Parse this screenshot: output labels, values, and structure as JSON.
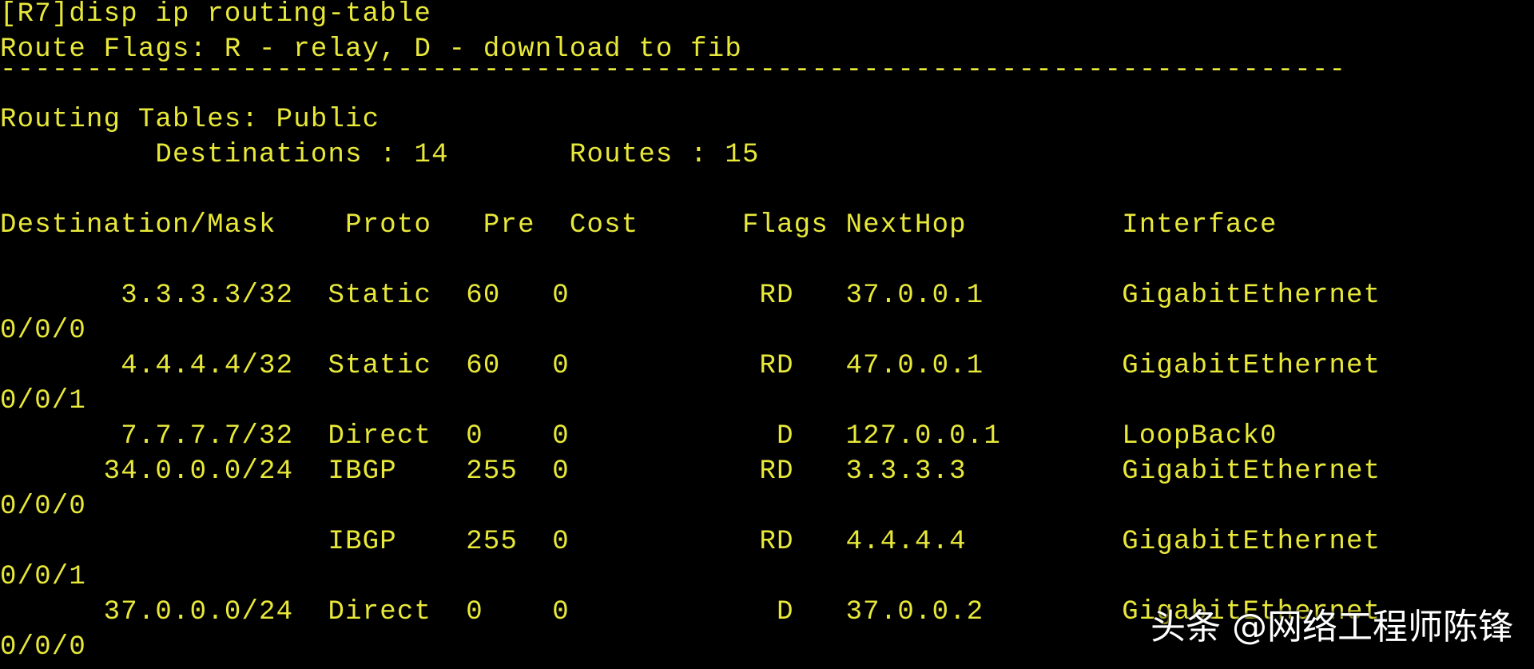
{
  "terminal": {
    "command": "[R7]disp ip routing-table",
    "flags_legend": "Route Flags: R - relay, D - download to fib",
    "separator": "------------------------------------------------------------------------------",
    "table_name": "Routing Tables: Public",
    "summary": "         Destinations : 14       Routes : 15",
    "header": "Destination/Mask    Proto   Pre  Cost      Flags NextHop         Interface",
    "rows": [
      "       3.3.3.3/32  Static  60   0           RD   37.0.0.1        GigabitEthernet",
      "0/0/0",
      "       4.4.4.4/32  Static  60   0           RD   47.0.0.1        GigabitEthernet",
      "0/0/1",
      "       7.7.7.7/32  Direct  0    0            D   127.0.0.1       LoopBack0",
      "      34.0.0.0/24  IBGP    255  0           RD   3.3.3.3         GigabitEthernet",
      "0/0/0",
      "                   IBGP    255  0           RD   4.4.4.4         GigabitEthernet",
      "0/0/1",
      "      37.0.0.0/24  Direct  0    0            D   37.0.0.2        GigabitEthernet",
      "0/0/0"
    ]
  },
  "watermark": {
    "text": "头条 @网络工程师陈锋"
  },
  "colors": {
    "background": "#000000",
    "terminal_text": "#e8e83a",
    "watermark_text": "#ffffff"
  }
}
